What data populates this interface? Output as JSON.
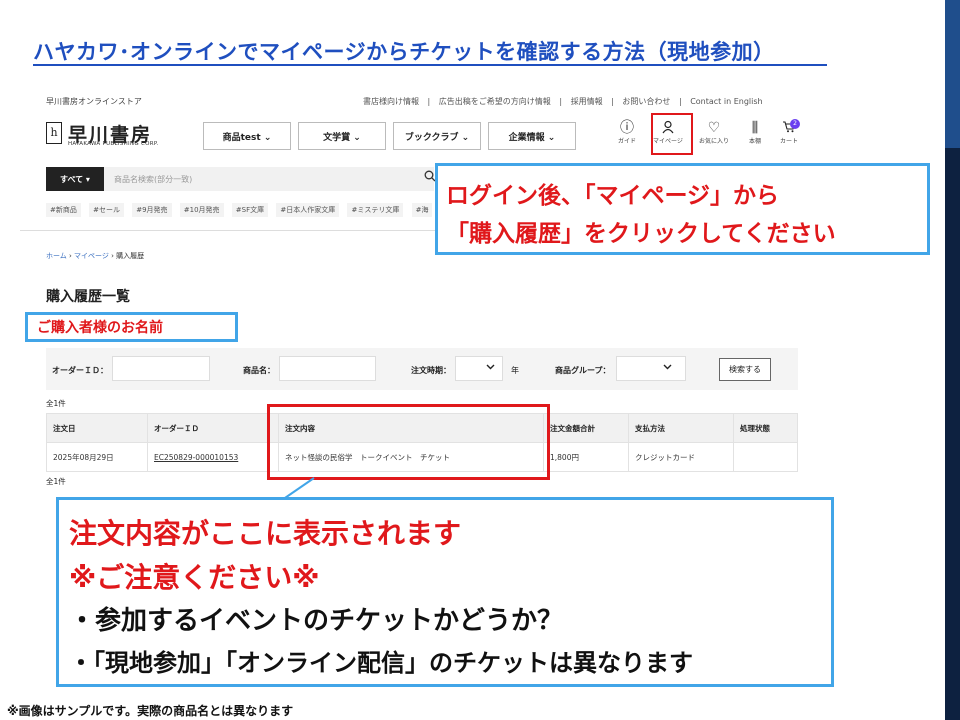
{
  "slide": {
    "title": "ハヤカワ･オンラインでマイページからチケットを確認する方法（現地参加）",
    "footnote": "※画像はサンプルです。実際の商品名とは異なります"
  },
  "site": {
    "store_name": "早川書房オンラインストア",
    "top_links": [
      "書店様向け情報",
      "|",
      "広告出稿をご希望の方向け情報",
      "|",
      "採用情報",
      "|",
      "お問い合わせ",
      "|",
      "Contact in English"
    ],
    "logo_mark": "h",
    "logo_text": "早川書房",
    "logo_sub": "HAYAKAWA PUBLISHING CORP.",
    "menus": [
      "商品test ⌄",
      "文学賞 ⌄",
      "ブッククラブ ⌄",
      "企業情報 ⌄"
    ],
    "icons": [
      {
        "glyph": "ⓘ",
        "label": "ガイド"
      },
      {
        "glyph": "⚲",
        "label": "マイページ"
      },
      {
        "glyph": "♡",
        "label": "お気に入り"
      },
      {
        "glyph": "⫼",
        "label": "本棚"
      },
      {
        "glyph": "🛒",
        "label": "カート"
      }
    ],
    "cart_count": "2",
    "search": {
      "category": "すべて ▾",
      "placeholder": "商品名検索(部分一致)",
      "icon": "search-icon"
    },
    "tags": [
      "#新商品",
      "#セール",
      "#9月発売",
      "#10月発売",
      "#SF文庫",
      "#日本人作家文庫",
      "#ミステリ文庫",
      "#海"
    ],
    "breadcrumb": {
      "home": "ホーム",
      "sep1": " › ",
      "mypage": "マイページ",
      "sep2": " › ",
      "current": "購入履歴"
    },
    "page_heading": "購入履歴一覧",
    "filters": {
      "order_id_label": "オーダーＩＤ：",
      "product_label": "商品名：",
      "period_label": "注文時期：",
      "year_suffix": "年",
      "group_label": "商品グループ：",
      "search_button": "検索する"
    },
    "count_top": "全1件",
    "count_bottom": "全1件",
    "table": {
      "headers": [
        "注文日",
        "オーダーＩＤ",
        "注文内容",
        "注文金額合計",
        "支払方法",
        "処理状態"
      ],
      "rows": [
        [
          "2025年08月29日",
          "EC250829-000010153",
          "ネット怪談の民俗学　トークイベント　チケット",
          "1,800円",
          "クレジットカード",
          ""
        ]
      ]
    }
  },
  "annotations": {
    "buyer_name": "ご購入者様のお名前",
    "callout1_line1": "ログイン後、「マイページ」から",
    "callout1_line2": "「購入履歴」をクリックしてください",
    "callout2_line1": "注文内容がここに表示されます",
    "callout2_line2": "※ご注意ください※",
    "callout2_line3": "・参加するイベントのチケットかどうか？",
    "callout2_line4": "・「現地参加」「オンライン配信」のチケットは異なります"
  },
  "colors": {
    "title": "#1f4fbf",
    "highlight_red": "#e0181b",
    "callout_border": "#41a5e8",
    "accent_bar": "#0d2140"
  }
}
